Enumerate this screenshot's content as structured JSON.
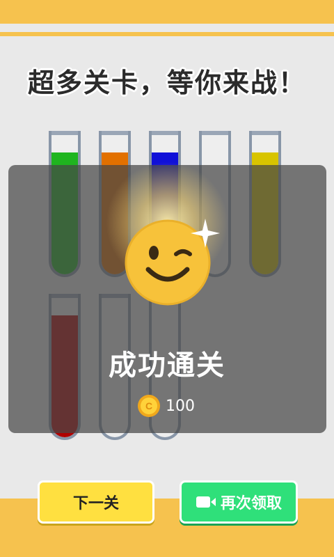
{
  "slogan": "超多关卡，等你来战！",
  "result": {
    "title": "成功通关",
    "coins": "100"
  },
  "buttons": {
    "next_label": "下一关",
    "claim_label": "再次领取"
  },
  "tubes": [
    {
      "color": "#1fb51f",
      "fill": 0.85
    },
    {
      "color": "#e27000",
      "fill": 0.85
    },
    {
      "color": "#1010d8",
      "fill": 0.85
    },
    {
      "color": "#ffffff",
      "fill": 0.0
    },
    {
      "color": "#d8c400",
      "fill": 0.85
    },
    {
      "color": "#b00000",
      "fill": 0.85
    },
    {
      "color": "#ffffff",
      "fill": 0.0
    },
    {
      "color": "#ffffff",
      "fill": 0.0
    }
  ],
  "colors": {
    "accent_yellow": "#f6c24e",
    "button_yellow": "#ffe040",
    "button_green": "#2fe07a"
  }
}
